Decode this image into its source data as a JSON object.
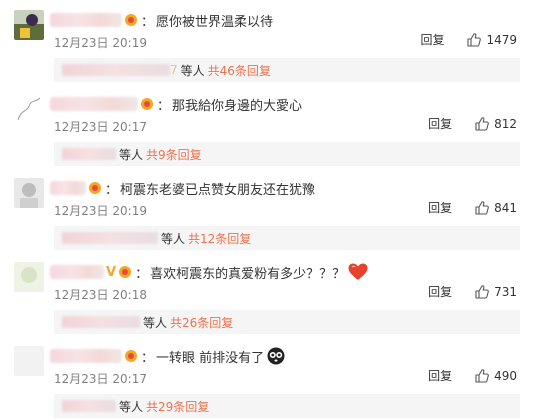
{
  "comments": [
    {
      "text": "愿你被世界温柔以待",
      "date": "12月23日",
      "time": "20:19",
      "reply_label": "回复",
      "likes": "1479",
      "sub": {
        "suffix": "等人",
        "count_text": "共46条回复",
        "visible_digit": "7"
      }
    },
    {
      "text": "那我給你身邊的大愛心",
      "date": "12月23日",
      "time": "20:17",
      "reply_label": "回复",
      "likes": "812",
      "sub": {
        "suffix": "等人",
        "count_text": "共9条回复"
      }
    },
    {
      "text": "柯震东老婆已点赞女朋友还在犹豫",
      "date": "12月23日",
      "time": "20:19",
      "reply_label": "回复",
      "likes": "841",
      "sub": {
        "suffix": "等人",
        "count_text": "共12条回复"
      }
    },
    {
      "text": "喜欢柯震东的真爱粉有多少？？？",
      "date": "12月23日",
      "time": "20:18",
      "reply_label": "回复",
      "likes": "731",
      "sub": {
        "suffix": "等人",
        "count_text": "共26条回复"
      }
    },
    {
      "text": "一转眼 前排没有了",
      "date": "12月23日",
      "time": "20:17",
      "reply_label": "回复",
      "likes": "490",
      "sub": {
        "suffix": "等人",
        "count_text": "共29条回复"
      }
    }
  ],
  "colors": {
    "link": "#eb7350",
    "meta": "#808080",
    "subbar_bg": "#f5f5f5",
    "heart": "#e8412c"
  },
  "icons": [
    "medal-icon",
    "like-icon",
    "heart-icon",
    "scared-face-icon",
    "vip-v-icon"
  ]
}
